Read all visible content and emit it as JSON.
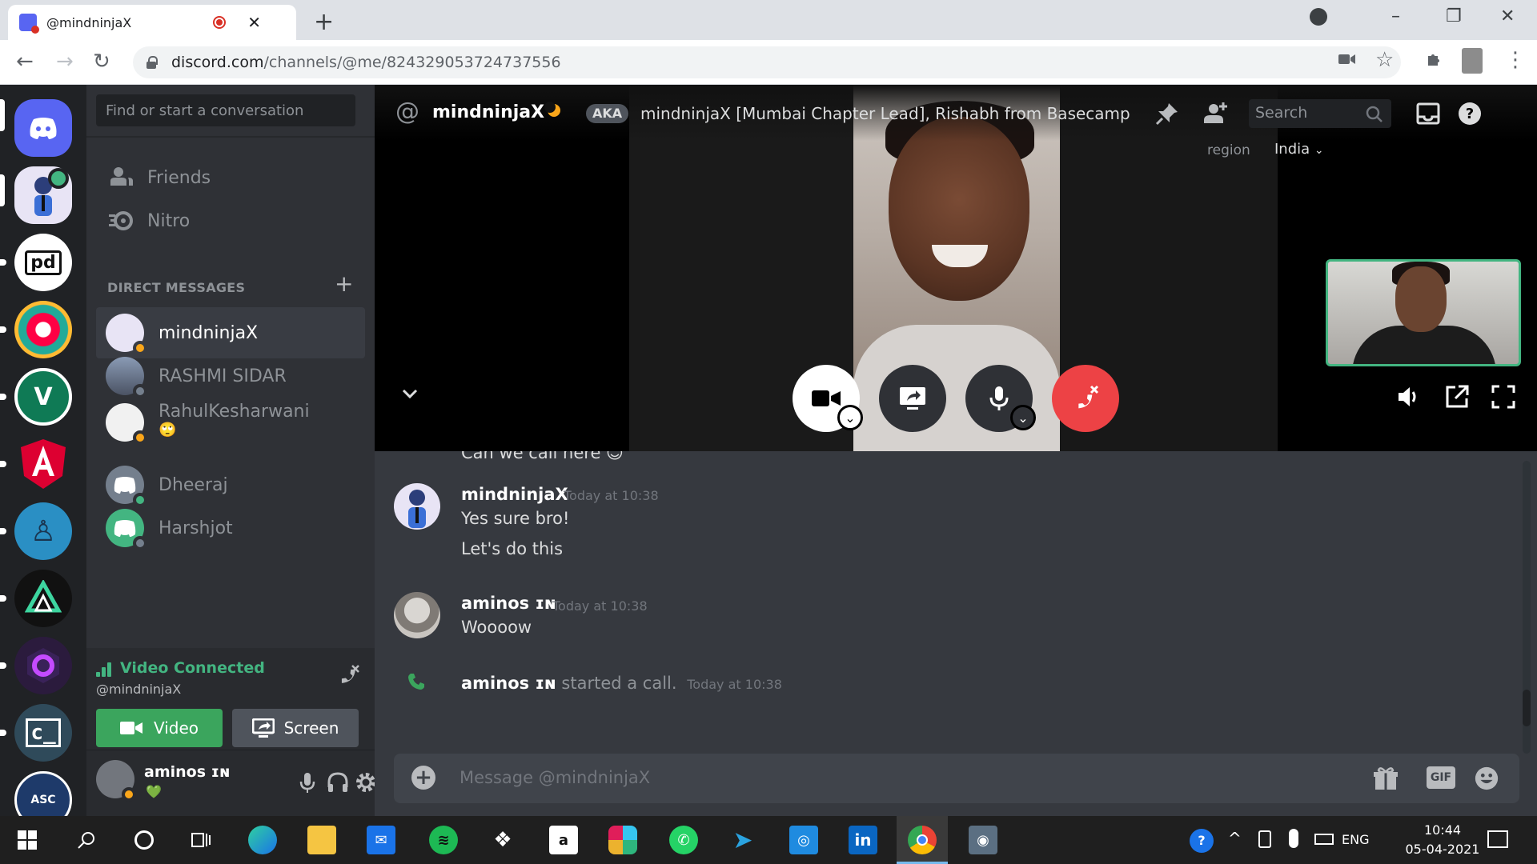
{
  "browser": {
    "tab_title": "@mindninjaX",
    "url_host": "discord.com",
    "url_path": "/channels/@me/824329053724737556"
  },
  "sidebar": {
    "search_placeholder": "Find or start a conversation",
    "nav": [
      {
        "label": "Friends"
      },
      {
        "label": "Nitro"
      }
    ],
    "dm_header": "DIRECT MESSAGES",
    "dms": [
      {
        "name": "mindninjaX",
        "status": "idle",
        "active": true
      },
      {
        "name": "RASHMI SIDAR",
        "status": "offline"
      },
      {
        "name": "RahulKesharwani",
        "status": "idle",
        "sub_emoji": "🙄"
      },
      {
        "name": "Dheeraj",
        "status": "online"
      },
      {
        "name": "Harshjot",
        "status": "offline"
      }
    ],
    "voice": {
      "title": "Video Connected",
      "subtitle": "@mindninjaX",
      "video_label": "Video",
      "screen_label": "Screen"
    },
    "user": {
      "name": "aminos ɪɴ",
      "sub": "💚"
    }
  },
  "header": {
    "at": "@",
    "name": "mindninjaX",
    "aka_badge": "AKA",
    "aka_text": "mindninjaX [Mumbai Chapter Lead], Rishabh from Basecamp",
    "search_placeholder": "Search",
    "region_label": "region",
    "region_value": "India"
  },
  "messages": {
    "partial_text": "Can we call here 😊",
    "items": [
      {
        "author": "mindninjaX",
        "time": "Today at 10:38",
        "lines": [
          "Yes sure bro!",
          "Let's do this"
        ]
      },
      {
        "author": "aminos ɪɴ",
        "time": "Today at 10:38",
        "lines": [
          "Woooow"
        ]
      }
    ],
    "system": {
      "author": "aminos ɪɴ",
      "text": "started a call.",
      "time": "Today at 10:38"
    },
    "input_placeholder": "Message @mindninjaX",
    "gif_label": "GIF"
  },
  "taskbar": {
    "lang": "ENG",
    "time": "10:44",
    "date": "05-04-2021"
  },
  "colors": {
    "blurple": "#5865f2",
    "green": "#43b581",
    "red": "#ed4245",
    "idle": "#faa61a"
  }
}
